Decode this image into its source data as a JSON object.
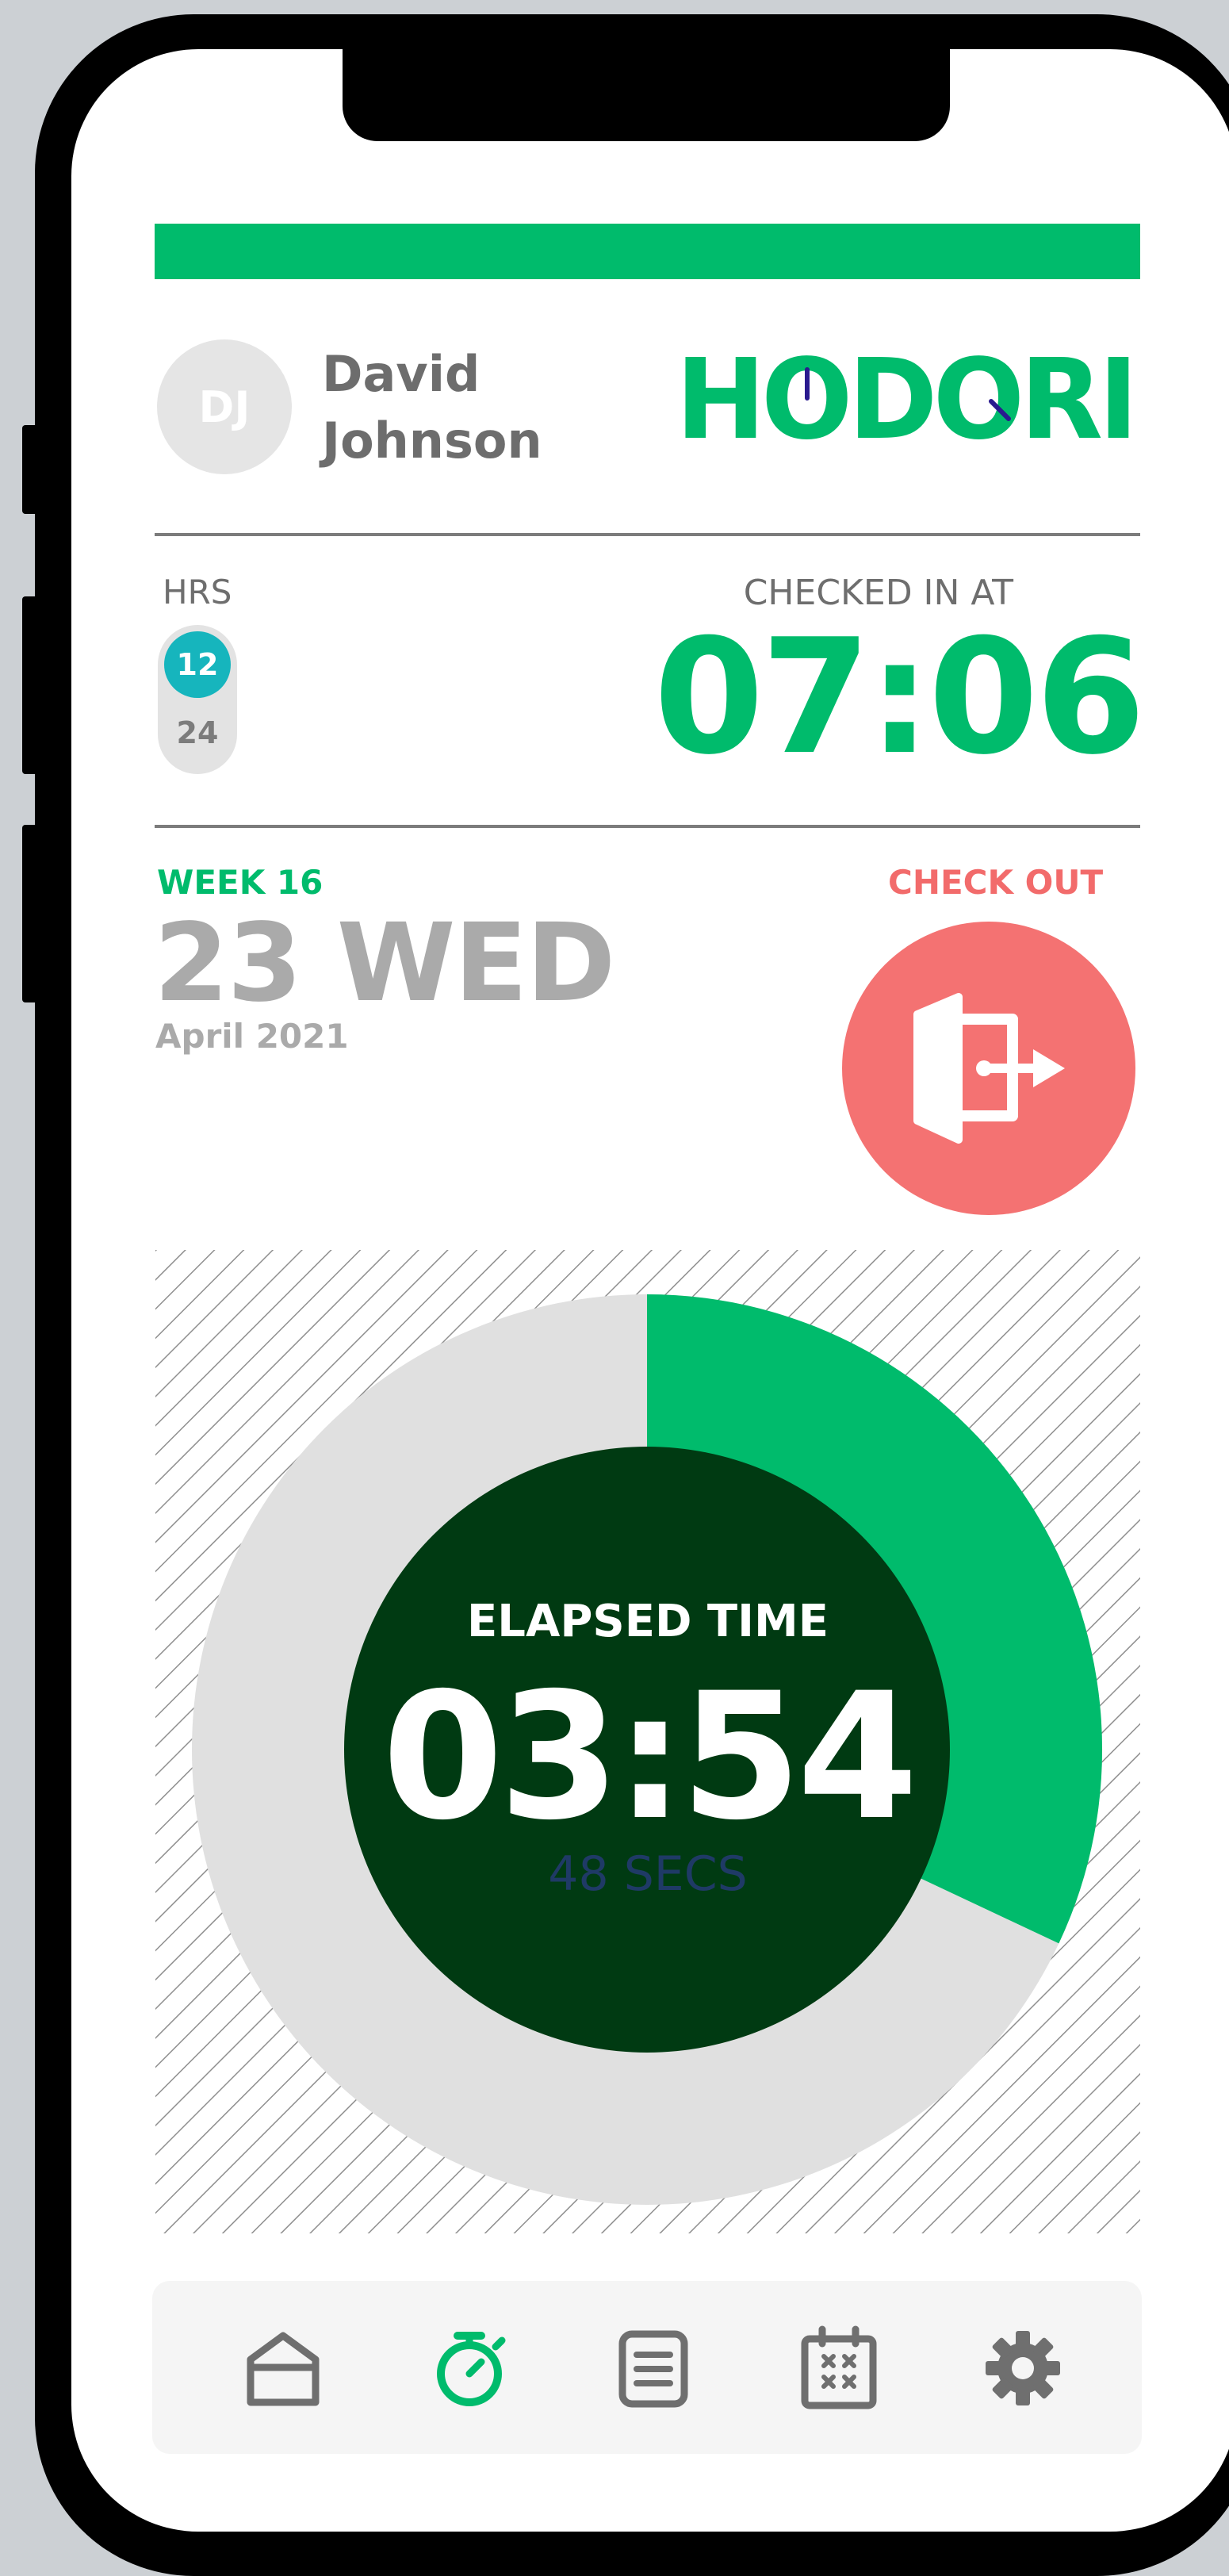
{
  "user": {
    "initials": "DJ",
    "first_name": "David",
    "last_name": "Johnson"
  },
  "brand": {
    "name": "HODORI"
  },
  "hours_format": {
    "label": "HRS",
    "options": [
      "12",
      "24"
    ],
    "selected": "12"
  },
  "checked_in": {
    "label": "CHECKED IN AT",
    "time": "07:06"
  },
  "date": {
    "week": "WEEK 16",
    "day": "23 WED",
    "month_year": "April 2021"
  },
  "check_out": {
    "label": "CHECK OUT"
  },
  "elapsed": {
    "label": "ELAPSED TIME",
    "time": "03:54",
    "seconds": "48 SECS",
    "progress_fraction": 0.32
  },
  "nav": {
    "items": [
      {
        "icon": "home-icon",
        "active": false
      },
      {
        "icon": "stopwatch-icon",
        "active": true
      },
      {
        "icon": "list-icon",
        "active": false
      },
      {
        "icon": "calendar-icon",
        "active": false
      },
      {
        "icon": "gear-icon",
        "active": false
      }
    ]
  },
  "colors": {
    "accent": "#00bb6c",
    "dark_green": "#003a12",
    "checkout": "#f47272",
    "toggle_active": "#16b5bd",
    "ring_track": "#e0e0e0",
    "seconds_text": "#1f3a66",
    "muted": "#aaaaaa"
  }
}
